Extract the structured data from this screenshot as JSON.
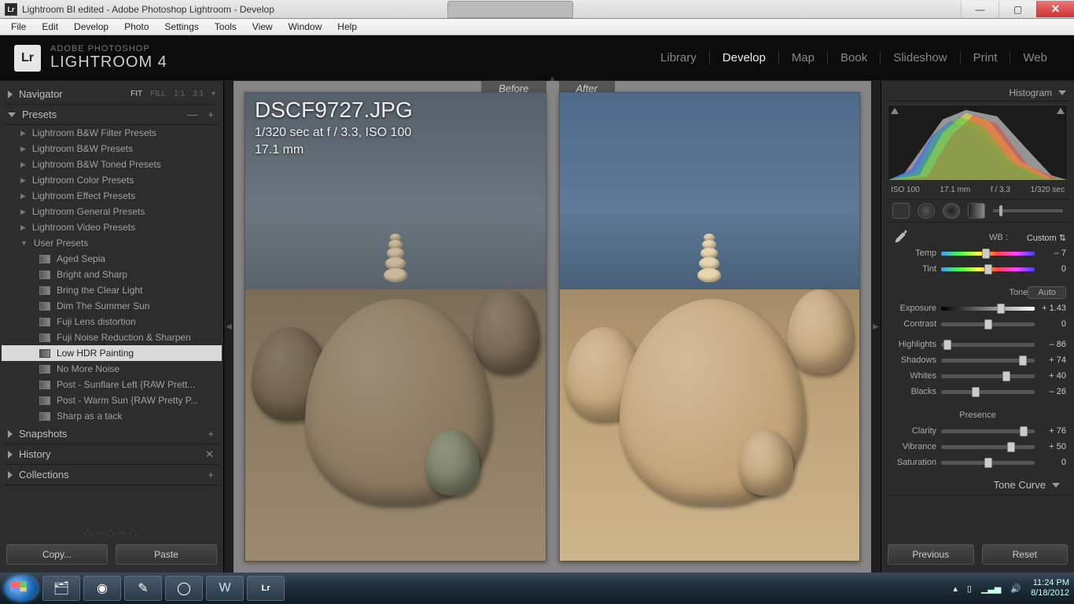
{
  "window": {
    "title": "Lightroom BI edited - Adobe Photoshop Lightroom - Develop",
    "logo": "Lr"
  },
  "menubar": [
    "File",
    "Edit",
    "Develop",
    "Photo",
    "Settings",
    "Tools",
    "View",
    "Window",
    "Help"
  ],
  "brand": {
    "line1": "ADOBE PHOTOSHOP",
    "line2": "LIGHTROOM 4",
    "logo": "Lr"
  },
  "modules": {
    "items": [
      "Library",
      "Develop",
      "Map",
      "Book",
      "Slideshow",
      "Print",
      "Web"
    ],
    "active": "Develop"
  },
  "left": {
    "navigator": {
      "title": "Navigator",
      "modes": [
        "FIT",
        "FILL",
        "1:1",
        "3:1"
      ]
    },
    "presets_title": "Presets",
    "preset_groups": [
      "Lightroom B&W Filter Presets",
      "Lightroom B&W Presets",
      "Lightroom B&W Toned Presets",
      "Lightroom Color Presets",
      "Lightroom Effect Presets",
      "Lightroom General Presets",
      "Lightroom Video Presets"
    ],
    "user_group": "User Presets",
    "user_presets": [
      "Aged Sepia",
      "Bright and Sharp",
      "Bring the Clear Light",
      "Dim The Summer Sun",
      "Fuji Lens distortion",
      "Fuji Noise Reduction & Sharpen",
      "Low HDR Painting",
      "No More Noise",
      "Post - Sunflare Left {RAW Prett...",
      "Post - Warm Sun {RAW Pretty P...",
      "Sharp as a tack"
    ],
    "selected_preset": "Low HDR Painting",
    "snapshots": "Snapshots",
    "history": "History",
    "collections": "Collections",
    "copy": "Copy...",
    "paste": "Paste"
  },
  "center": {
    "before": "Before",
    "after": "After",
    "filename": "DSCF9727.JPG",
    "meta1": "1/320 sec at f / 3.3, ISO 100",
    "meta2": "17.1 mm"
  },
  "right": {
    "histogram_title": "Histogram",
    "histo_info": {
      "iso": "ISO 100",
      "focal": "17.1 mm",
      "aperture": "f / 3.3",
      "shutter": "1/320 sec"
    },
    "wb_label": "WB :",
    "wb_value": "Custom",
    "temp_label": "Temp",
    "temp_value": "– 7",
    "tint_label": "Tint",
    "tint_value": "0",
    "tone_label": "Tone",
    "auto_label": "Auto",
    "exposure_label": "Exposure",
    "exposure_value": "+ 1.43",
    "contrast_label": "Contrast",
    "contrast_value": "0",
    "highlights_label": "Highlights",
    "highlights_value": "– 86",
    "shadows_label": "Shadows",
    "shadows_value": "+ 74",
    "whites_label": "Whites",
    "whites_value": "+ 40",
    "blacks_label": "Blacks",
    "blacks_value": "– 26",
    "presence_label": "Presence",
    "clarity_label": "Clarity",
    "clarity_value": "+ 76",
    "vibrance_label": "Vibrance",
    "vibrance_value": "+ 50",
    "saturation_label": "Saturation",
    "saturation_value": "0",
    "tone_curve": "Tone Curve",
    "previous": "Previous",
    "reset": "Reset"
  },
  "slider_pos": {
    "temp": 48,
    "tint": 50,
    "exposure": 64,
    "contrast": 50,
    "highlights": 7,
    "shadows": 87,
    "whites": 70,
    "blacks": 37,
    "clarity": 88,
    "vibrance": 75,
    "saturation": 50
  },
  "taskbar": {
    "time": "11:24 PM",
    "date": "8/18/2012"
  }
}
